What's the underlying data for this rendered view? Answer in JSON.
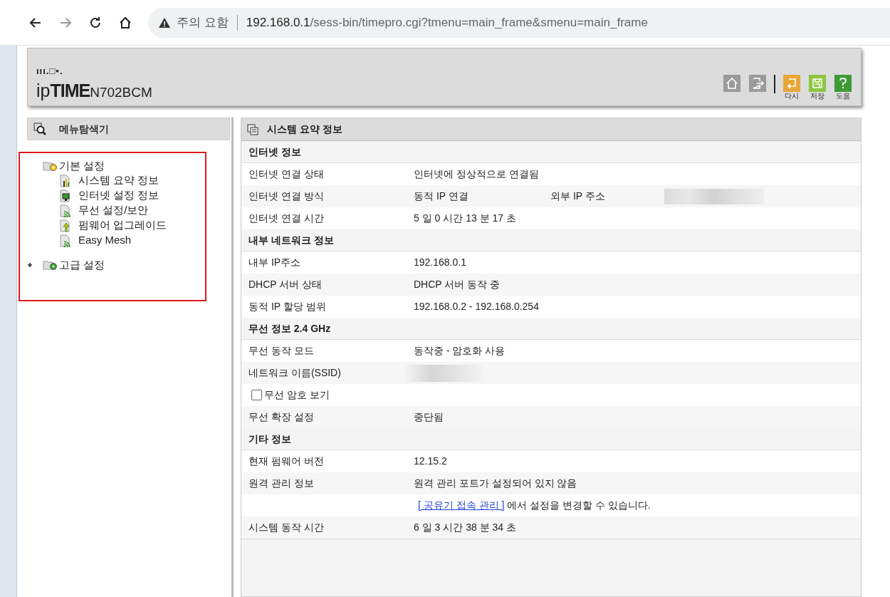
{
  "browser": {
    "warning": "주의 요함",
    "url_host": "192.168.0.1",
    "url_path": "/sess-bin/timepro.cgi?tmenu=main_frame&smenu=main_frame"
  },
  "header": {
    "logo_small": "ııı.□▪.",
    "brand_light": "ip",
    "brand_bold": "TIME",
    "model": "N702BCM",
    "tools": [
      {
        "kind": "home"
      },
      {
        "kind": "logout"
      },
      {
        "kind": "undo",
        "label": "다시"
      },
      {
        "kind": "save",
        "label": "저장"
      },
      {
        "kind": "help",
        "label": "도움"
      }
    ]
  },
  "sidebar": {
    "title": "메뉴탐색기",
    "tree": [
      {
        "label": "기본 설정",
        "expanded": true,
        "children": [
          {
            "label": "시스템 요약 정보",
            "kind": "chart"
          },
          {
            "label": "인터넷 설정 정보",
            "kind": "monitor"
          },
          {
            "label": "무선 설정/보안",
            "kind": "wifi"
          },
          {
            "label": "펌웨어 업그레이드",
            "kind": "upgrade"
          },
          {
            "label": "Easy Mesh",
            "kind": "wifi"
          }
        ]
      },
      {
        "label": "고급 설정",
        "expanded": false
      }
    ]
  },
  "main": {
    "title": "시스템 요약 정보",
    "sections": [
      {
        "title": "인터넷 정보",
        "rows": [
          {
            "kind": "text",
            "label": "인터넷 연결 상태",
            "value": "인터넷에 정상적으로 연결됨"
          },
          {
            "kind": "pair",
            "label": "인터넷 연결 방식",
            "value": "동적 IP 연결",
            "label2": "외부 IP 주소"
          },
          {
            "kind": "text",
            "label": "인터넷 연결 시간",
            "value": "5 일 0 시간 13 분 17 초"
          }
        ]
      },
      {
        "title": "내부 네트워크 정보",
        "rows": [
          {
            "kind": "text",
            "label": "내부 IP주소",
            "value": "192.168.0.1"
          },
          {
            "kind": "text",
            "label": "DHCP 서버 상태",
            "value": "DHCP 서버 동작 중"
          },
          {
            "kind": "text",
            "label": "동적 IP 할당 범위",
            "value": "192.168.0.2 -  192.168.0.254"
          }
        ]
      },
      {
        "title": "무선 정보 2.4 GHz",
        "rows": [
          {
            "kind": "text",
            "label": "무선 동작 모드",
            "value": "동작중 - 암호화 사용"
          },
          {
            "kind": "blurred",
            "label": "네트워크 이름(SSID)"
          },
          {
            "kind": "checkbox",
            "label": "무선 암호 보기",
            "checked": false
          },
          {
            "kind": "text",
            "label": "무선 확장 설정",
            "value": "중단됨"
          }
        ]
      },
      {
        "title": "기타 정보",
        "rows": [
          {
            "kind": "text",
            "label": "현재 펌웨어 버전",
            "value": "12.15.2"
          },
          {
            "kind": "text",
            "label": "원격 관리 정보",
            "value": "원격 관리 포트가 설정되어 있지 않음"
          },
          {
            "kind": "link",
            "link": "[ 공유기 접속 관리 ]",
            "value": " 에서 설정을 변경할 수 있습니다."
          },
          {
            "kind": "text",
            "label": "시스템 동작 시간",
            "value": "6 일 3 시간 38 분 34 초"
          }
        ]
      }
    ]
  }
}
